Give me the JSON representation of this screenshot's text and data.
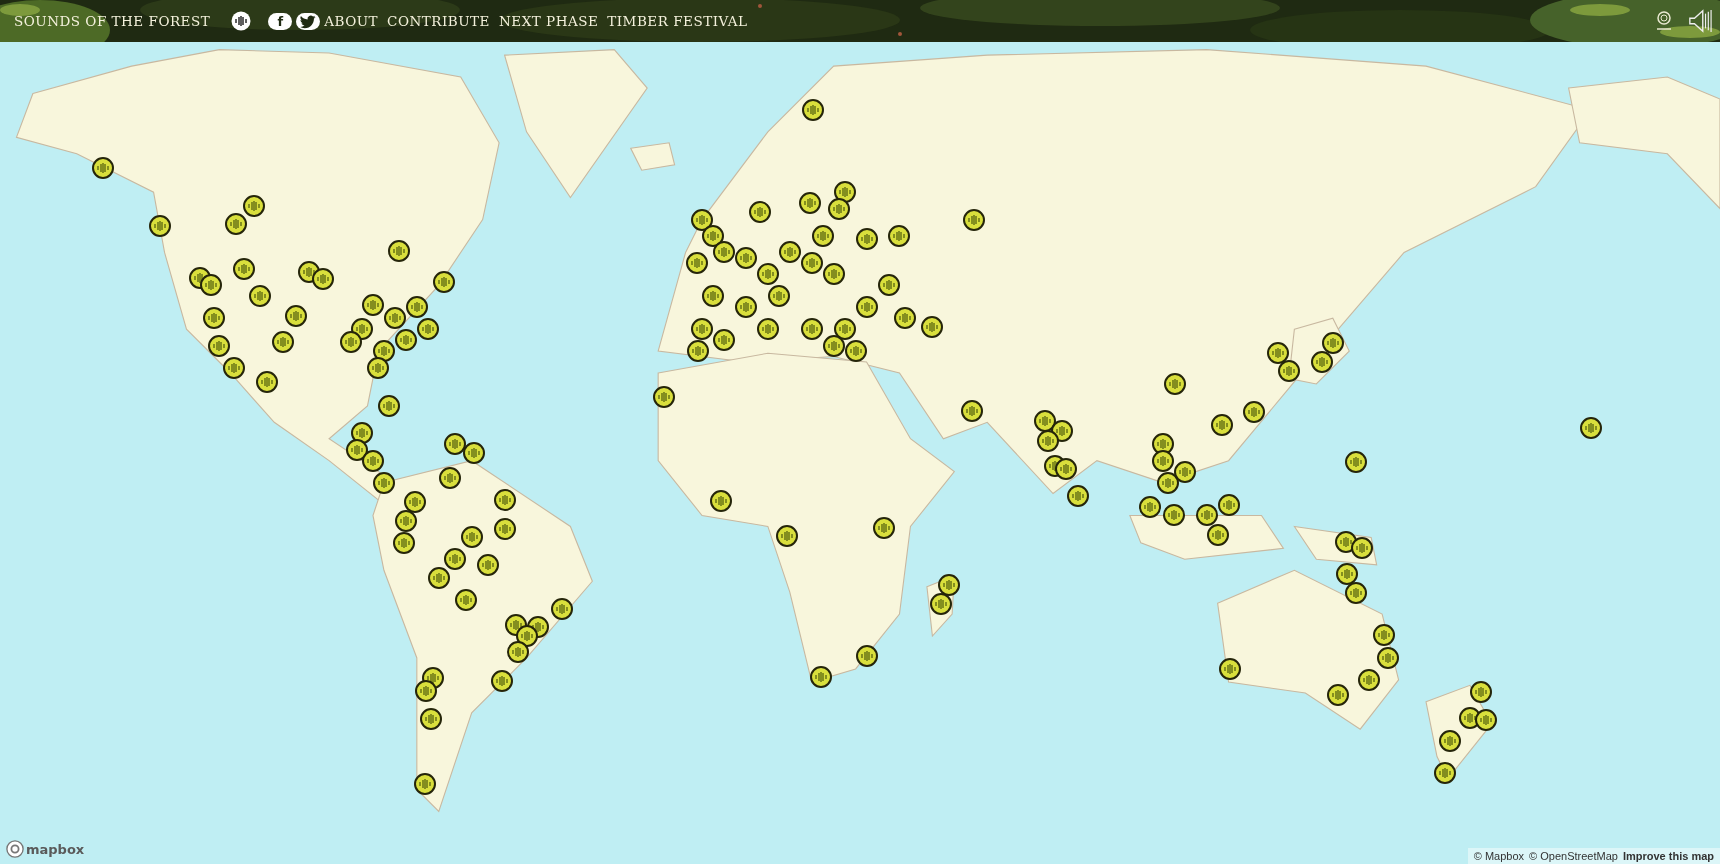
{
  "header": {
    "brand": "SOUNDS OF THE FOREST",
    "links": [
      {
        "kind": "sound"
      },
      {
        "kind": "facebook",
        "glyph": "f"
      },
      {
        "kind": "twitter"
      },
      {
        "kind": "text",
        "label": "ABOUT"
      },
      {
        "kind": "text",
        "label": "CONTRIBUTE"
      },
      {
        "kind": "text",
        "label": "NEXT PHASE"
      },
      {
        "kind": "text",
        "label": "TIMBER FESTIVAL"
      }
    ]
  },
  "map": {
    "logo": "mapbox",
    "attribution": [
      {
        "label": "© Mapbox",
        "bold": false
      },
      {
        "label": "© OpenStreetMap",
        "bold": false
      },
      {
        "label": "Improve this map",
        "bold": true
      }
    ]
  }
}
